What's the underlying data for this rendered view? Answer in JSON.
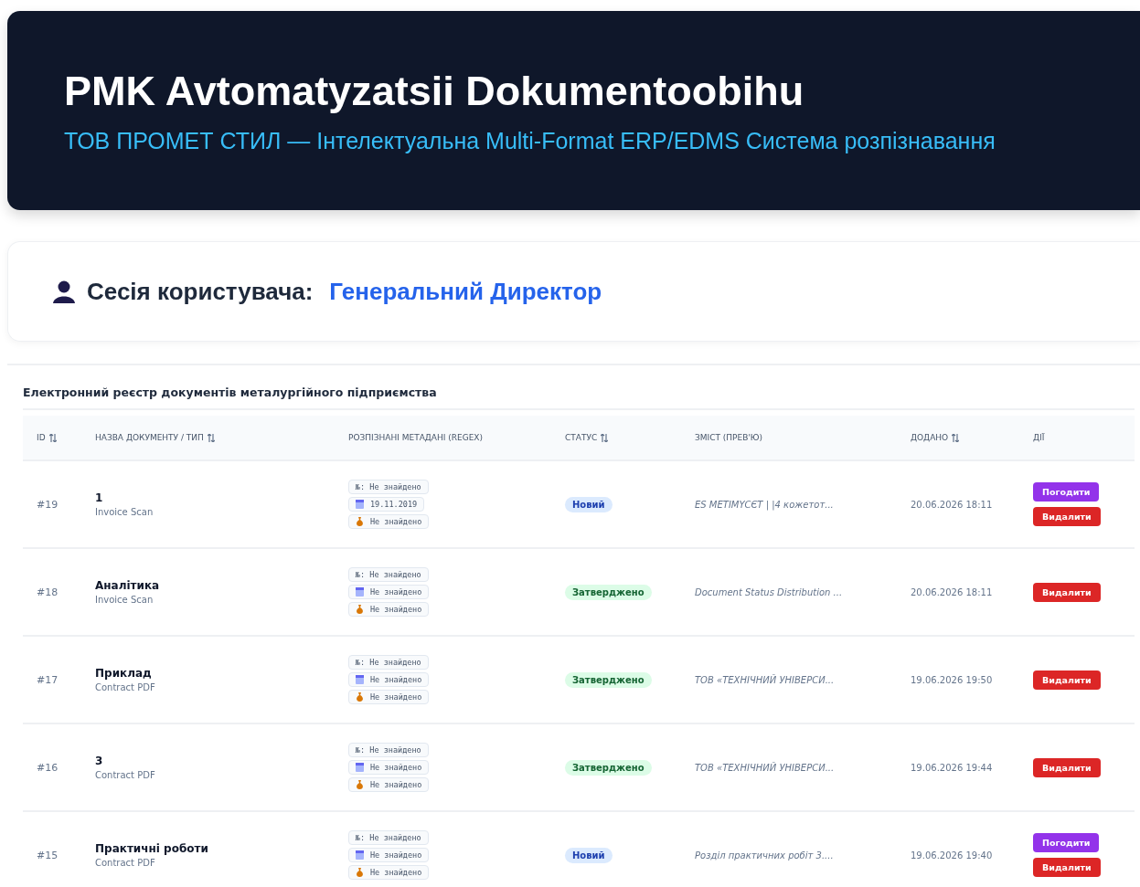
{
  "header": {
    "title": "PMK Avtomatyzatsii Dokumentoobihu",
    "subtitle": "ТОВ ПРОМЕТ СТИЛ — Інтелектуальна Multi-Format ERP/EDMS Система розпізнавання"
  },
  "session": {
    "label": "Сесія користувача:",
    "value": "Генеральний Директор"
  },
  "registry": {
    "title": "Електронний реєстр документів металургійного підприємства",
    "columns": [
      {
        "label": "ID",
        "sortable": true
      },
      {
        "label": "НАЗВА ДОКУМЕНТУ / ТИП",
        "sortable": true
      },
      {
        "label": "РОЗПІЗНАНІ МЕТАДАНІ (REGEX)",
        "sortable": false
      },
      {
        "label": "СТАТУС",
        "sortable": true
      },
      {
        "label": "ЗМІСТ (ПРЕВ'Ю)",
        "sortable": false
      },
      {
        "label": "ДОДАНО",
        "sortable": true
      },
      {
        "label": "ДІЇ",
        "sortable": false
      }
    ],
    "rows": [
      {
        "id": "#19",
        "name": "1",
        "type": "Invoice Scan",
        "meta": [
          {
            "kind": "number",
            "text": "№: Не знайдено"
          },
          {
            "kind": "date",
            "text": "19.11.2019"
          },
          {
            "kind": "amount",
            "text": "Не знайдено"
          }
        ],
        "status": {
          "kind": "new",
          "label": "Новий"
        },
        "preview": "ES METIMYCЄT | |4 кожетот...",
        "added": "20.06.2026 18:11",
        "actions": [
          {
            "kind": "approve",
            "label": "Погодити"
          },
          {
            "kind": "delete",
            "label": "Видалити"
          }
        ]
      },
      {
        "id": "#18",
        "name": "Аналітика",
        "type": "Invoice Scan",
        "meta": [
          {
            "kind": "number",
            "text": "№: Не знайдено"
          },
          {
            "kind": "date",
            "text": "Не знайдено"
          },
          {
            "kind": "amount",
            "text": "Не знайдено"
          }
        ],
        "status": {
          "kind": "approved",
          "label": "Затверджено"
        },
        "preview": "Document Status Distribution ...",
        "added": "20.06.2026 18:11",
        "actions": [
          {
            "kind": "delete",
            "label": "Видалити"
          }
        ]
      },
      {
        "id": "#17",
        "name": "Приклад",
        "type": "Contract PDF",
        "meta": [
          {
            "kind": "number",
            "text": "№: Не знайдено"
          },
          {
            "kind": "date",
            "text": "Не знайдено"
          },
          {
            "kind": "amount",
            "text": "Не знайдено"
          }
        ],
        "status": {
          "kind": "approved",
          "label": "Затверджено"
        },
        "preview": "ТОВ «ТЕХНІЧНИЙ УНІВЕРСИ...",
        "added": "19.06.2026 19:50",
        "actions": [
          {
            "kind": "delete",
            "label": "Видалити"
          }
        ]
      },
      {
        "id": "#16",
        "name": "3",
        "type": "Contract PDF",
        "meta": [
          {
            "kind": "number",
            "text": "№: Не знайдено"
          },
          {
            "kind": "date",
            "text": "Не знайдено"
          },
          {
            "kind": "amount",
            "text": "Не знайдено"
          }
        ],
        "status": {
          "kind": "approved",
          "label": "Затверджено"
        },
        "preview": "ТОВ «ТЕХНІЧНИЙ УНІВЕРСИ...",
        "added": "19.06.2026 19:44",
        "actions": [
          {
            "kind": "delete",
            "label": "Видалити"
          }
        ]
      },
      {
        "id": "#15",
        "name": "Практичні роботи",
        "type": "Contract PDF",
        "meta": [
          {
            "kind": "number",
            "text": "№: Не знайдено"
          },
          {
            "kind": "date",
            "text": "Не знайдено"
          },
          {
            "kind": "amount",
            "text": "Не знайдено"
          }
        ],
        "status": {
          "kind": "new",
          "label": "Новий"
        },
        "preview": "Розділ практичних робіт 3....",
        "added": "19.06.2026 19:40",
        "actions": [
          {
            "kind": "approve",
            "label": "Погодити"
          },
          {
            "kind": "delete",
            "label": "Видалити"
          }
        ]
      }
    ]
  }
}
